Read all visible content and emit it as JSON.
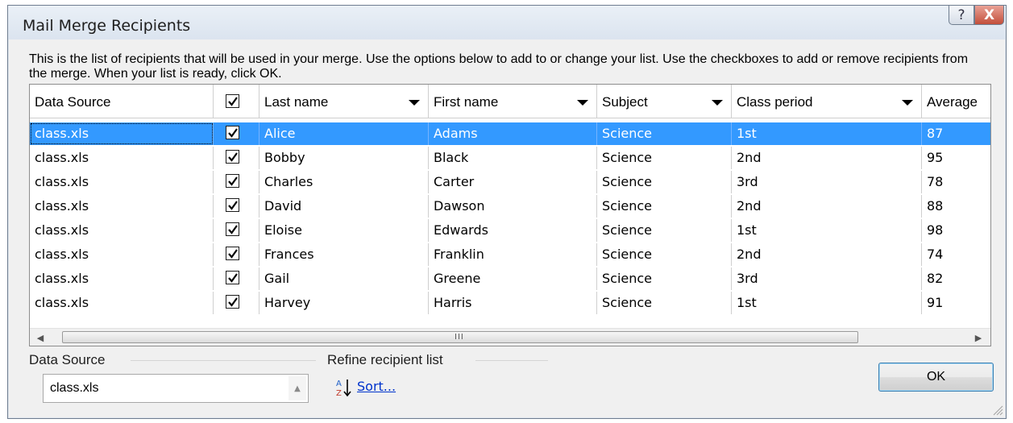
{
  "dialog": {
    "title": "Mail Merge Recipients",
    "help_glyph": "?",
    "close_glyph": "X",
    "description": "This is the list of recipients that will be used in your merge.  Use the options below to add to or change your list.  Use the checkboxes to add or remove recipients from the merge.  When your list is ready, click OK."
  },
  "grid": {
    "columns": [
      "Data Source",
      "Last name",
      "First name",
      "Subject",
      "Class period",
      "Average"
    ],
    "rows": [
      {
        "source": "class.xls",
        "checked": true,
        "last": "Alice",
        "first": "Adams",
        "subject": "Science",
        "period": "1st",
        "average": "87",
        "selected": true
      },
      {
        "source": "class.xls",
        "checked": true,
        "last": "Bobby",
        "first": "Black",
        "subject": "Science",
        "period": "2nd",
        "average": "95"
      },
      {
        "source": "class.xls",
        "checked": true,
        "last": "Charles",
        "first": "Carter",
        "subject": "Science",
        "period": "3rd",
        "average": "78"
      },
      {
        "source": "class.xls",
        "checked": true,
        "last": "David",
        "first": "Dawson",
        "subject": "Science",
        "period": "2nd",
        "average": "88"
      },
      {
        "source": "class.xls",
        "checked": true,
        "last": "Eloise",
        "first": "Edwards",
        "subject": "Science",
        "period": "1st",
        "average": "98"
      },
      {
        "source": "class.xls",
        "checked": true,
        "last": "Frances",
        "first": "Franklin",
        "subject": "Science",
        "period": "2nd",
        "average": "74"
      },
      {
        "source": "class.xls",
        "checked": true,
        "last": "Gail",
        "first": "Greene",
        "subject": "Science",
        "period": "3rd",
        "average": "82"
      },
      {
        "source": "class.xls",
        "checked": true,
        "last": "Harvey",
        "first": "Harris",
        "subject": "Science",
        "period": "1st",
        "average": "91"
      }
    ],
    "scroll_grip": "III"
  },
  "data_source_panel": {
    "label": "Data Source",
    "items": [
      "class.xls"
    ]
  },
  "refine_panel": {
    "label": "Refine recipient list",
    "sort_link": "Sort..."
  },
  "buttons": {
    "ok": "OK"
  },
  "colors": {
    "selection": "#3399ff",
    "link": "#0033cc"
  },
  "icons": [
    "help-icon",
    "close-icon",
    "dropdown-arrow-icon",
    "checkmark-icon",
    "scroll-left-icon",
    "scroll-right-icon",
    "sort-az-icon",
    "resize-grip-icon"
  ]
}
